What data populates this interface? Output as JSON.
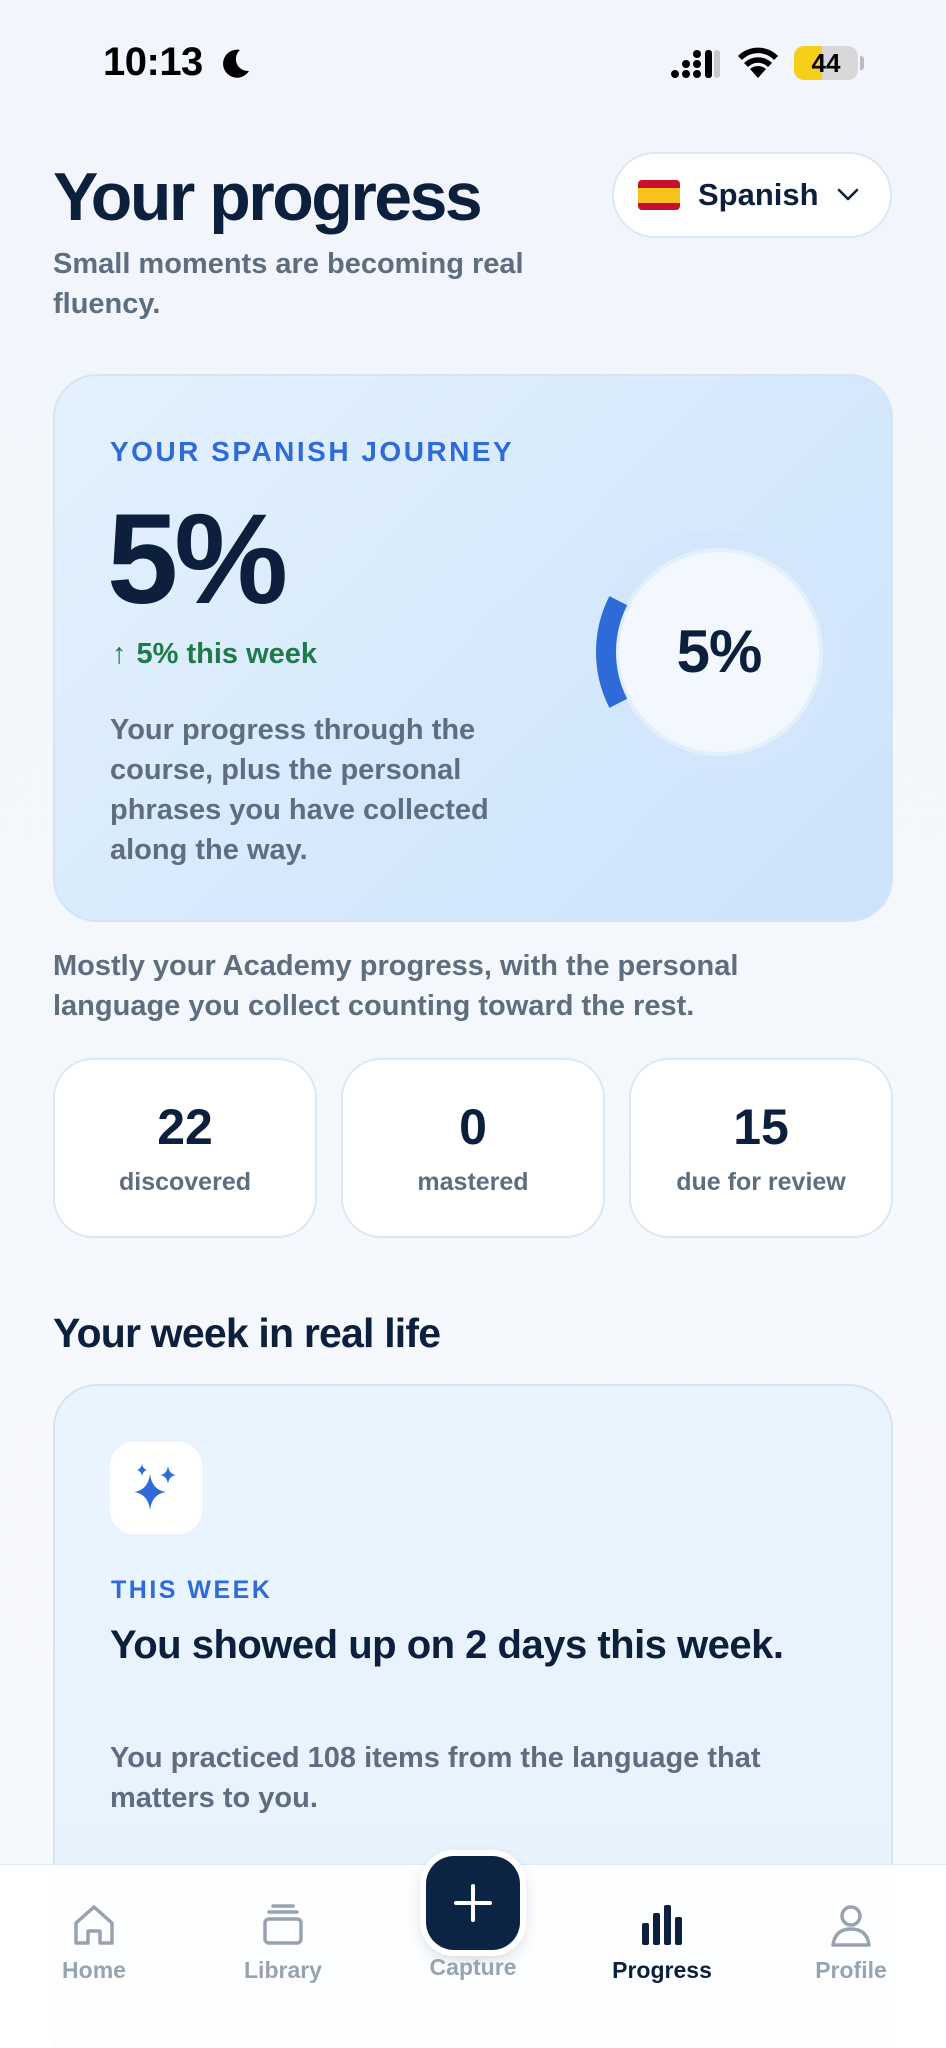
{
  "status_bar": {
    "time": "10:13",
    "battery": "44",
    "battery_level": 0.44
  },
  "header": {
    "title": "Your progress",
    "subtitle": "Small moments are becoming real fluency.",
    "language": "Spanish"
  },
  "journey": {
    "eyebrow": "YOUR SPANISH JOURNEY",
    "percent": "5%",
    "delta_arrow": "↑",
    "delta": "5% this week",
    "description": "Your progress through the course, plus the personal phrases you have collected along the way.",
    "ring_label": "5%",
    "ring_fraction": 0.05
  },
  "explain": "Mostly your Academy progress, with the personal language you collect counting toward the rest.",
  "stats": [
    {
      "value": "22",
      "label": "discovered"
    },
    {
      "value": "0",
      "label": "mastered"
    },
    {
      "value": "15",
      "label": "due for review"
    }
  ],
  "week_section": {
    "title": "Your week in real life",
    "eyebrow": "THIS WEEK",
    "headline": "You showed up on 2 days this week.",
    "body": "You practiced 108 items from the language that matters to you."
  },
  "tabs": [
    {
      "label": "Home",
      "icon": "home-icon"
    },
    {
      "label": "Library",
      "icon": "library-icon"
    },
    {
      "label": "Capture",
      "icon": "plus-icon"
    },
    {
      "label": "Progress",
      "icon": "bar-chart-icon"
    },
    {
      "label": "Profile",
      "icon": "person-icon"
    }
  ],
  "colors": {
    "accent": "#2f6bd8",
    "navy": "#0c1f3c",
    "positive": "#1f7a4a",
    "battery": "#f6cf1a"
  }
}
